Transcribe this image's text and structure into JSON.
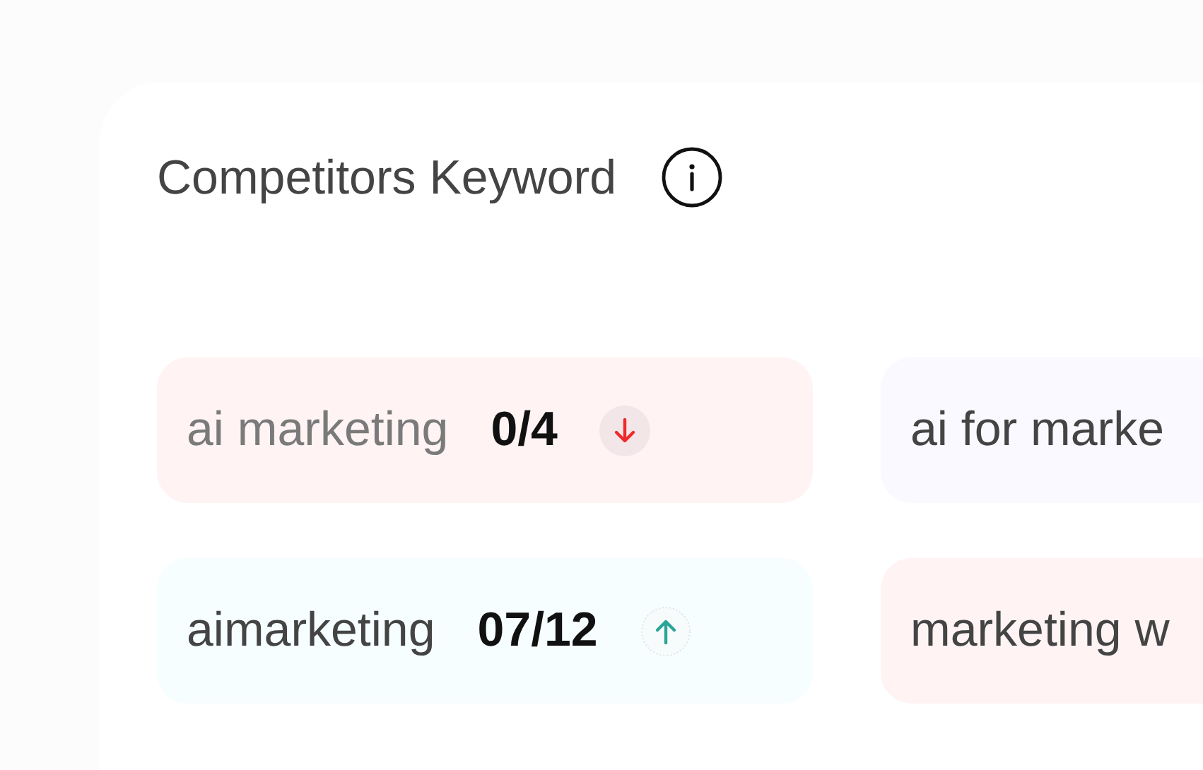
{
  "title": "Competitors Keyword",
  "keywords": [
    {
      "keyword": "ai marketing",
      "dimmed": true,
      "rank": "0/4",
      "rising": false,
      "color": "#fff3f4"
    },
    {
      "keyword": "ai for marke",
      "dimmed": false,
      "color": "#f9f9ff"
    },
    {
      "keyword": "aimarketing",
      "dimmed": false,
      "rank": "07/12",
      "rising": true,
      "color": "#f6feff"
    },
    {
      "keyword": "marketing w",
      "dimmed": false,
      "color": "#fff3f4"
    }
  ]
}
